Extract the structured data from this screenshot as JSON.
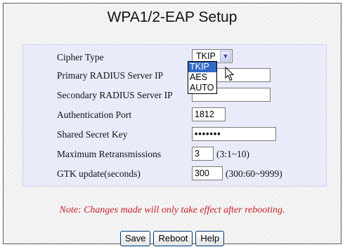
{
  "page": {
    "title": "WPA1/2-EAP Setup",
    "note": "Note: Changes made will only take effect after rebooting."
  },
  "form": {
    "cipher_type": {
      "label": "Cipher Type",
      "selected": "TKIP",
      "options": [
        "TKIP",
        "AES",
        "AUTO"
      ]
    },
    "primary_radius": {
      "label": "Primary RADIUS Server IP",
      "value": ""
    },
    "secondary_radius": {
      "label": "Secondary RADIUS Server IP",
      "value": ""
    },
    "auth_port": {
      "label": "Authentication Port",
      "value": "1812"
    },
    "shared_secret": {
      "label": "Shared Secret Key",
      "value": "•••••••"
    },
    "max_retrans": {
      "label": "Maximum Retransmissions",
      "value": "3",
      "hint": "(3:1~10)"
    },
    "gtk_update": {
      "label": "GTK update(seconds)",
      "value": "300",
      "hint": "(300:60~9999)"
    }
  },
  "buttons": {
    "save": "Save",
    "reboot": "Reboot",
    "help": "Help"
  },
  "icons": {
    "dropdown_arrow": "chevron-down-icon",
    "cursor": "pointer-icon"
  },
  "colors": {
    "panel": "#e9ebfa",
    "note": "#c8202a",
    "selection": "#316ac5"
  }
}
